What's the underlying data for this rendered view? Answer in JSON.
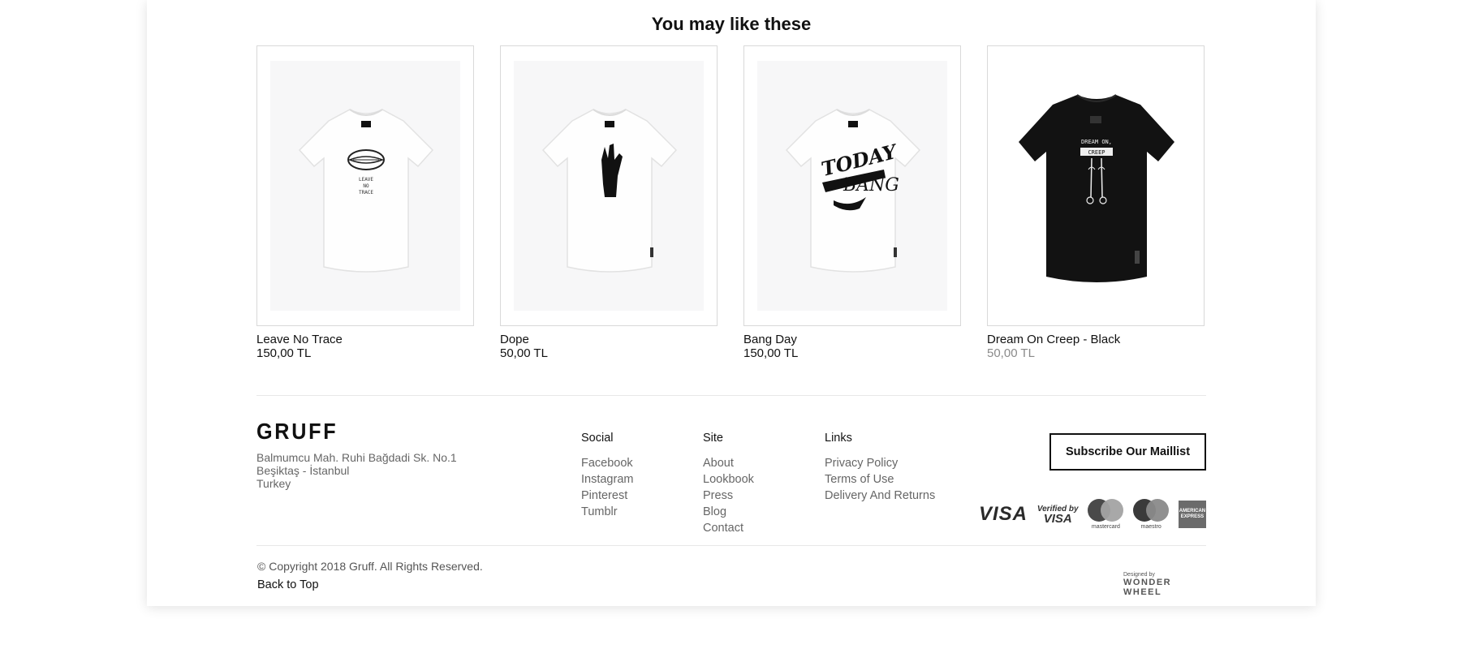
{
  "related": {
    "title": "You may like these",
    "products": [
      {
        "name": "Leave No Trace",
        "price": "150,00 TL",
        "shirt_color": "#ffffff",
        "graphic": "lips-icon",
        "price_muted": false
      },
      {
        "name": "Dope",
        "price": "50,00 TL",
        "shirt_color": "#ffffff",
        "graphic": "hand-gesture-icon",
        "price_muted": false
      },
      {
        "name": "Bang Day",
        "price": "150,00 TL",
        "shirt_color": "#ffffff",
        "graphic": "gun-hand-icon",
        "price_muted": false
      },
      {
        "name": "Dream On Creep - Black",
        "price": "50,00 TL",
        "shirt_color": "#111111",
        "graphic": "legs-icon",
        "price_muted": true
      }
    ]
  },
  "footer": {
    "logo": "GRUFF",
    "address": [
      "Balmumcu Mah. Ruhi Bağdadi Sk. No.1",
      "Beşiktaş - İstanbul",
      "Turkey"
    ],
    "social": {
      "title": "Social",
      "links": [
        "Facebook",
        "Instagram",
        "Pinterest",
        "Tumblr"
      ]
    },
    "site": {
      "title": "Site",
      "links": [
        "About",
        "Lookbook",
        "Press",
        "Blog",
        "Contact"
      ]
    },
    "links": {
      "title": "Links",
      "links": [
        "Privacy Policy",
        "Terms of Use",
        "Delivery And Returns"
      ]
    },
    "subscribe_label": "Subscribe Our Maillist",
    "payments": {
      "visa": "VISA",
      "verified_line1": "Verified by",
      "verified_line2": "VISA",
      "mastercard": "mastercard",
      "maestro": "maestro",
      "amex": "AMERICAN EXPRESS"
    },
    "copyright": "© Copyright 2018 Gruff. All Rights Reserved.",
    "back_to_top": "Back to Top",
    "designed_by": "Designed by",
    "designer": "WONDER WHEEL"
  }
}
